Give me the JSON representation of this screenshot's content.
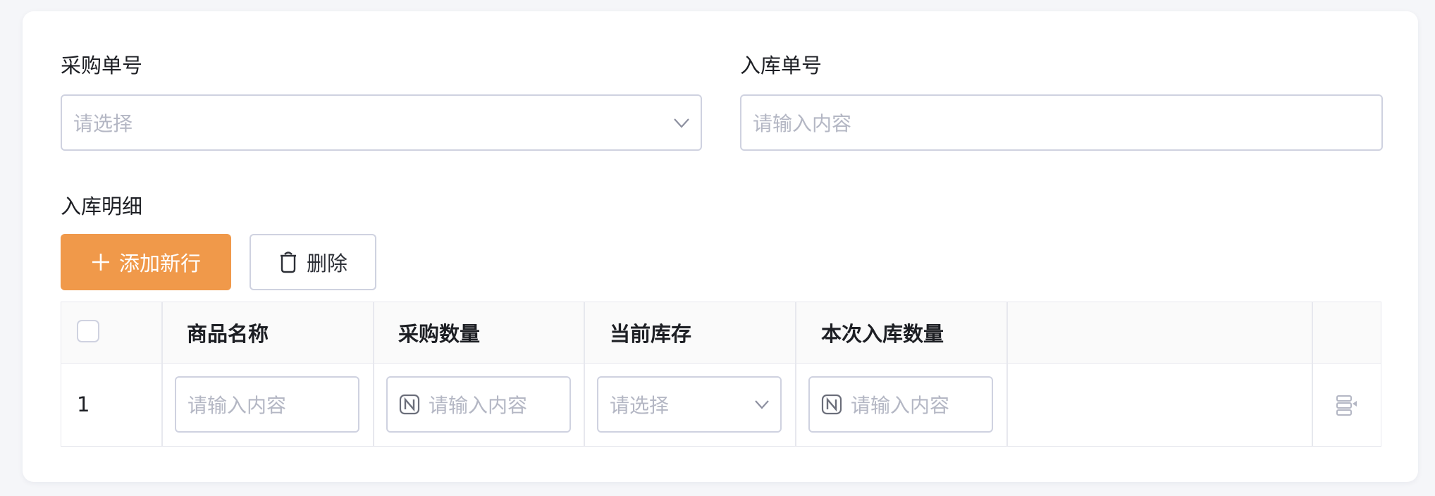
{
  "form": {
    "purchase_order": {
      "label": "采购单号",
      "placeholder": "请选择",
      "icon": "chevron-down-icon"
    },
    "stock_in_no": {
      "label": "入库单号",
      "placeholder": "请输入内容"
    }
  },
  "details": {
    "title": "入库明细",
    "add_button": "添加新行",
    "delete_button": "删除"
  },
  "table": {
    "columns": [
      "商品名称",
      "采购数量",
      "当前库存",
      "本次入库数量"
    ],
    "rows": [
      {
        "index": "1",
        "product_name_placeholder": "请输入内容",
        "purchase_qty_placeholder": "请输入内容",
        "current_stock_placeholder": "请选择",
        "stock_in_qty_placeholder": "请输入内容"
      }
    ]
  },
  "colors": {
    "primary": "#f0994a",
    "border": "#cfd2e0",
    "placeholder": "#b4b7c4",
    "header_bg": "#fafafa"
  }
}
